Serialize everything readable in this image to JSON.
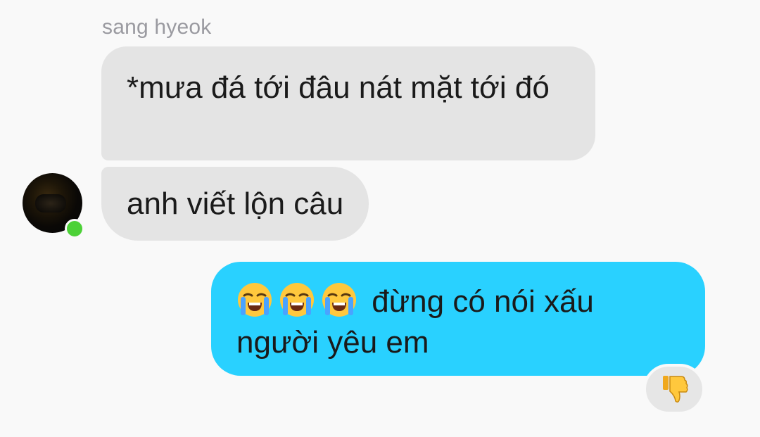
{
  "conversation": {
    "sender_name": "sang hyeok",
    "incoming": [
      {
        "text": "*mưa đá tới đâu nát mặt tới đó"
      },
      {
        "text": "anh viết lộn câu"
      }
    ],
    "outgoing": [
      {
        "emoji": [
          "loudly-crying-face",
          "loudly-crying-face",
          "loudly-crying-face"
        ],
        "text": "đừng có nói xấu người yêu em"
      }
    ],
    "reaction": {
      "icon": "thumbs-down-icon"
    },
    "avatar": {
      "status": "online"
    }
  },
  "colors": {
    "incoming_bubble": "#e4e4e4",
    "outgoing_bubble": "#29d1ff",
    "online": "#4cd137",
    "background": "#f9f9f9"
  }
}
